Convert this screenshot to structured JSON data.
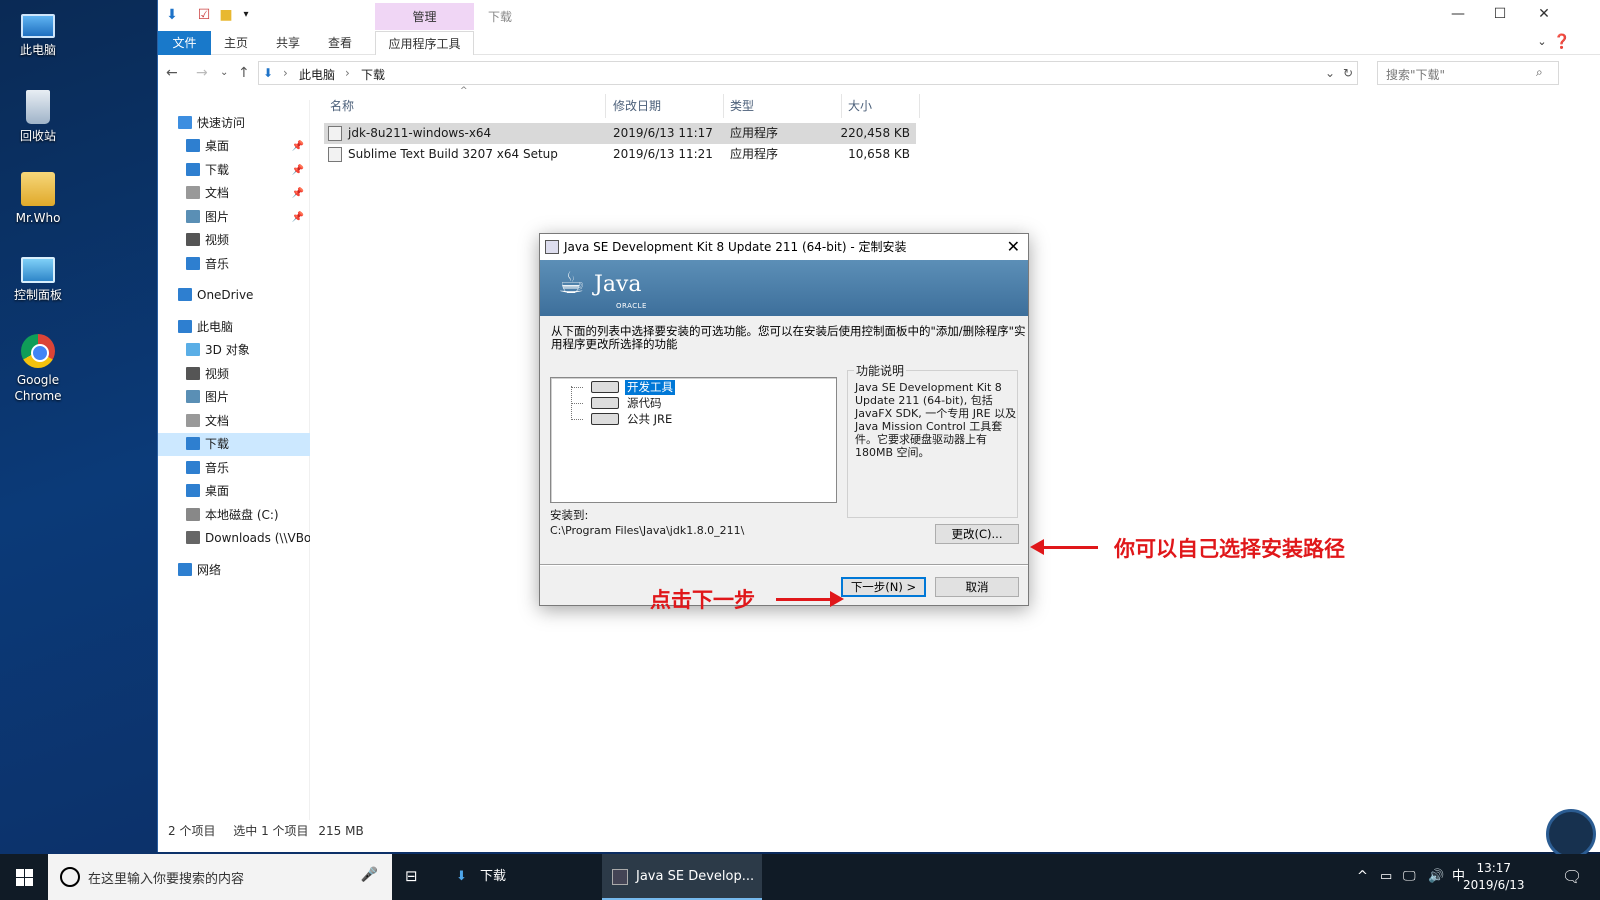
{
  "desktop": {
    "icons": [
      {
        "label": "此电脑"
      },
      {
        "label": "回收站"
      },
      {
        "label": "Mr.Who"
      },
      {
        "label": "控制面板"
      },
      {
        "label": "Google Chrome"
      }
    ]
  },
  "explorer": {
    "title": "下载",
    "manage_tab": "管理",
    "ribbon_tabs": [
      "文件",
      "主页",
      "共享",
      "查看",
      "应用程序工具"
    ],
    "address": [
      "此电脑",
      "下载"
    ],
    "search_placeholder": "搜索\"下载\"",
    "nav": [
      {
        "label": "快速访问",
        "pinned": false
      },
      {
        "label": "桌面",
        "pinned": true
      },
      {
        "label": "下载",
        "pinned": true
      },
      {
        "label": "文档",
        "pinned": true
      },
      {
        "label": "图片",
        "pinned": true
      },
      {
        "label": "视频",
        "pinned": false
      },
      {
        "label": "音乐",
        "pinned": false
      },
      {
        "label": "OneDrive",
        "pinned": false
      },
      {
        "label": "此电脑",
        "pinned": false
      },
      {
        "label": "3D 对象",
        "pinned": false
      },
      {
        "label": "视频",
        "pinned": false
      },
      {
        "label": "图片",
        "pinned": false
      },
      {
        "label": "文档",
        "pinned": false
      },
      {
        "label": "下载",
        "pinned": false
      },
      {
        "label": "音乐",
        "pinned": false
      },
      {
        "label": "桌面",
        "pinned": false
      },
      {
        "label": "本地磁盘 (C:)",
        "pinned": false
      },
      {
        "label": "Downloads (\\\\VBox",
        "pinned": false
      },
      {
        "label": "网络",
        "pinned": false
      }
    ],
    "columns": [
      "名称",
      "修改日期",
      "类型",
      "大小"
    ],
    "files": [
      {
        "name": "jdk-8u211-windows-x64",
        "date": "2019/6/13 11:17",
        "type": "应用程序",
        "size": "220,458 KB"
      },
      {
        "name": "Sublime Text Build 3207 x64 Setup",
        "date": "2019/6/13 11:21",
        "type": "应用程序",
        "size": "10,658 KB"
      }
    ],
    "status": {
      "count": "2 个项目",
      "selected": "选中 1 个项目",
      "size": "215 MB"
    }
  },
  "dialog": {
    "title": "Java SE Development Kit 8 Update 211 (64-bit) - 定制安装",
    "logo_text": "Java",
    "logo_sub": "ORACLE",
    "instructions": "从下面的列表中选择要安装的可选功能。您可以在安装后使用控制面板中的\"添加/删除程序\"实用程序更改所选择的功能",
    "features": [
      "开发工具",
      "源代码",
      "公共 JRE"
    ],
    "feature_desc_legend": "功能说明",
    "feature_desc": "Java SE Development Kit 8 Update 211 (64-bit), 包括 JavaFX SDK, 一个专用 JRE 以及 Java Mission Control 工具套件。它要求硬盘驱动器上有 180MB 空间。",
    "install_to_label": "安装到:",
    "install_path": "C:\\Program Files\\Java\\jdk1.8.0_211\\",
    "change_button": "更改(C)...",
    "next_button": "下一步(N) >",
    "cancel_button": "取消"
  },
  "annotations": {
    "path_hint": "你可以自己选择安装路径",
    "next_hint": "点击下一步"
  },
  "taskbar": {
    "search_placeholder": "在这里输入你要搜索的内容",
    "apps": [
      {
        "label": "下载"
      },
      {
        "label": "Java SE Develop..."
      }
    ],
    "ime": "中",
    "time": "13:17",
    "date": "2019/6/13"
  }
}
